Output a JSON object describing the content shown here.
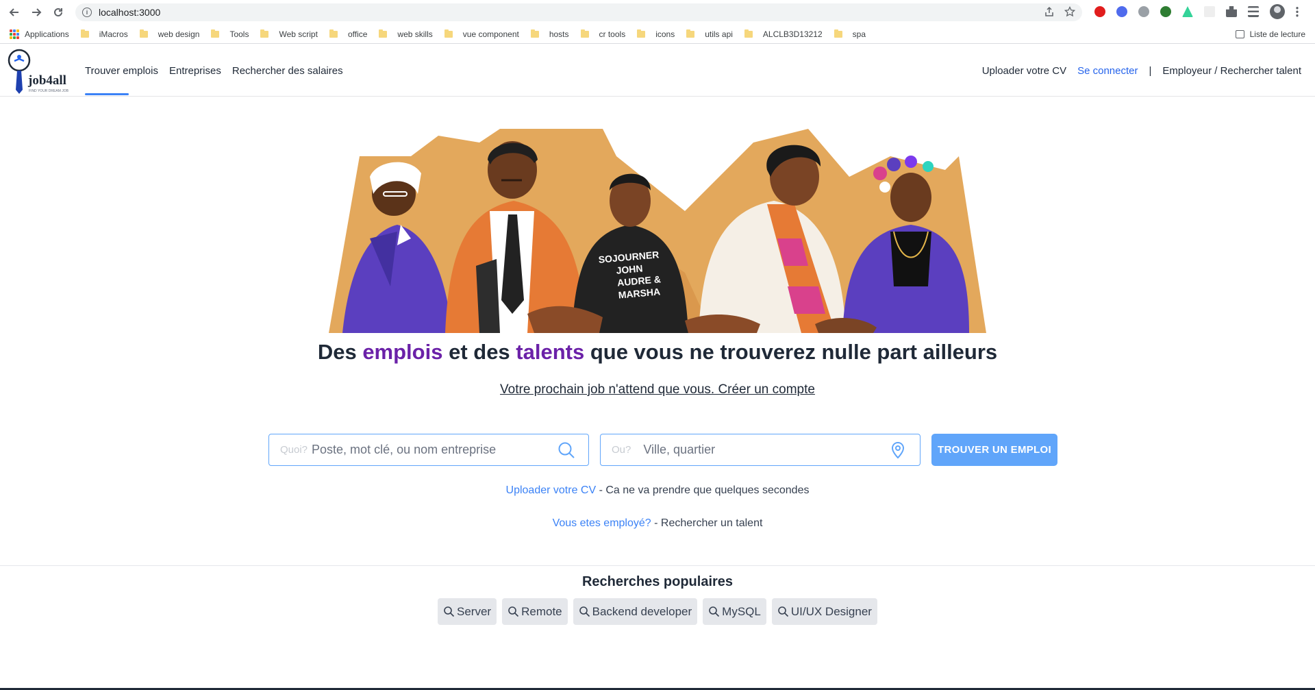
{
  "browser": {
    "url": "localhost:3000",
    "bookmarks": [
      "Applications",
      "iMacros",
      "web design",
      "Tools",
      "Web script",
      "office",
      "web skills",
      "vue component",
      "hosts",
      "cr tools",
      "icons",
      "utils api",
      "ALCLB3D13212",
      "spa"
    ],
    "reading_list": "Liste de lecture"
  },
  "site": {
    "logo_text": "job4all",
    "logo_tagline": "FIND YOUR DREAM JOB",
    "nav": [
      "Trouver emplois",
      "Entreprises",
      "Rechercher des salaires"
    ],
    "right_nav": {
      "upload": "Uploader votre CV",
      "connect": "Se connecter",
      "separator": "|",
      "employer": "Employeur / Rechercher talent"
    }
  },
  "hero": {
    "shirt_text": [
      "SOJOURNER",
      "JOHN",
      "AUDRE &",
      "MARSHA"
    ],
    "headline": {
      "p1": "Des ",
      "emph1": "emplois",
      "p2": " et des ",
      "emph2": "talents",
      "p3": " que vous ne trouverez nulle part ailleurs"
    },
    "subline": "Votre prochain job n'attend que vous. Créer un compte"
  },
  "search": {
    "what_label": "Quoi?",
    "what_placeholder": "Poste, mot clé, ou nom entreprise",
    "where_label": "Ou?",
    "where_placeholder": "Ville, quartier",
    "button": "TROUVER UN EMPLOI"
  },
  "cta": {
    "upload_link": "Uploader votre CV",
    "upload_rest": " - Ca ne va prendre que quelques secondes",
    "employer_link": "Vous etes employé?",
    "employer_rest": " - Rechercher un talent"
  },
  "popular": {
    "title": "Recherches populaires",
    "items": [
      "Server",
      "Remote",
      "Backend developer",
      "MySQL",
      "UI/UX Designer"
    ]
  },
  "colors": {
    "accent_blue": "#60a5fa",
    "link_blue": "#3b82f6",
    "purple": "#6b21a8",
    "sand": "#e3a85c"
  }
}
